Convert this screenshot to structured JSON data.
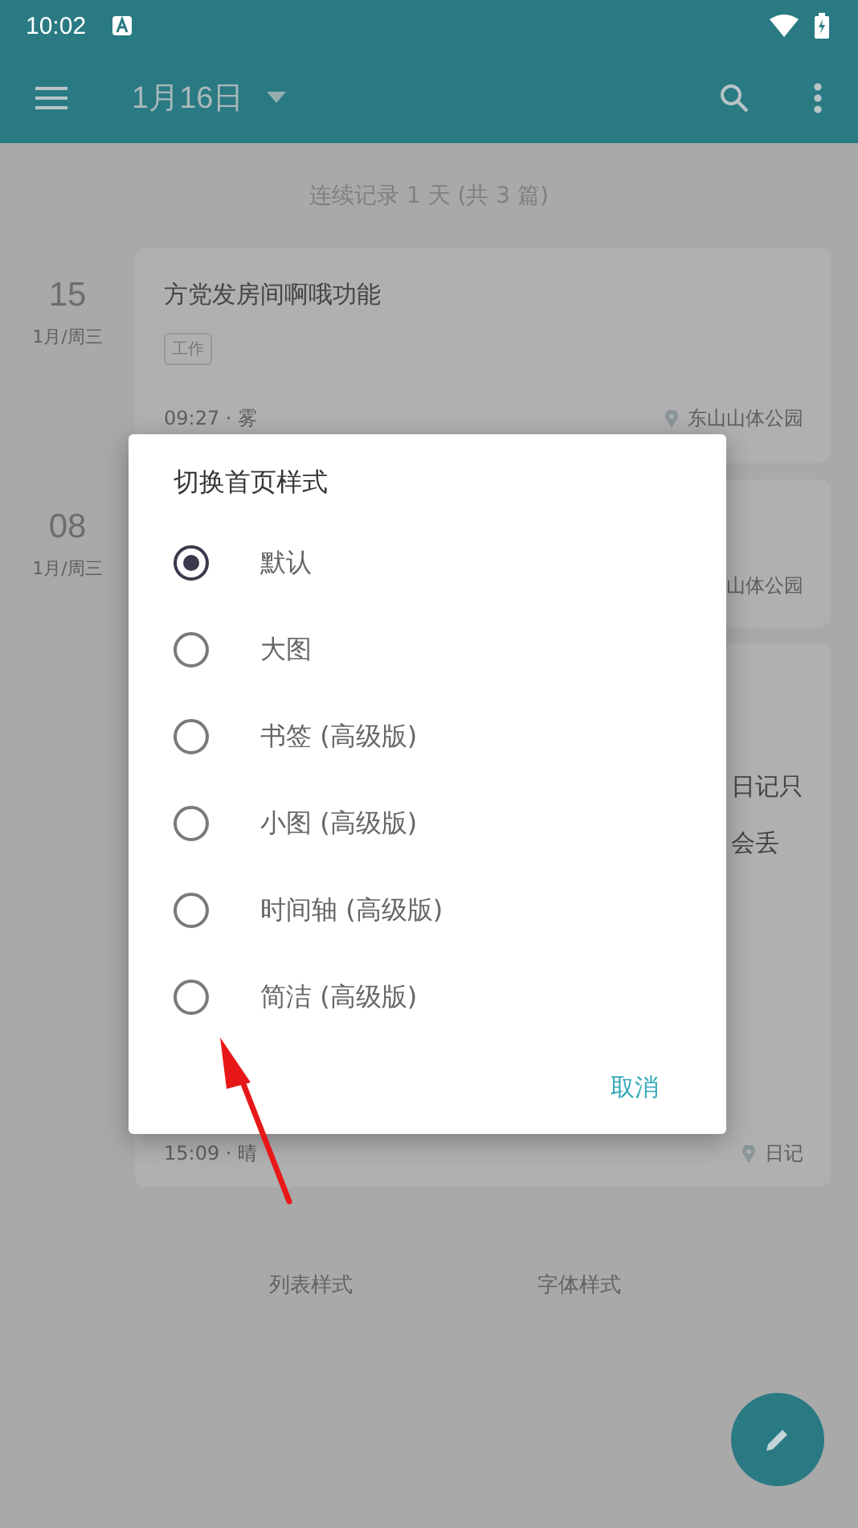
{
  "status_bar": {
    "time": "10:02"
  },
  "toolbar": {
    "title": "1月16日"
  },
  "summary": "连续记录 1 天 (共 3 篇)",
  "entries": [
    {
      "day": "15",
      "weekday": "1月/周三",
      "kind": "full",
      "title": "方党发房间啊哦功能",
      "tag": "工作",
      "time": "09:27 · 雾",
      "location": "东山山体公园"
    },
    {
      "day": "08",
      "weekday": "1月/周三",
      "kind": "covered",
      "location": "山体公园"
    },
    {
      "kind": "long",
      "lines": [
        "日记只",
        "会丢"
      ],
      "time": "15:09 · 晴",
      "location": "日记"
    }
  ],
  "bottom_tabs": [
    "列表样式",
    "字体样式"
  ],
  "dialog": {
    "title": "切换首页样式",
    "options": [
      {
        "label": "默认",
        "selected": true
      },
      {
        "label": "大图",
        "selected": false
      },
      {
        "label": "书签 (高级版)",
        "selected": false
      },
      {
        "label": "小图 (高级版)",
        "selected": false
      },
      {
        "label": "时间轴 (高级版)",
        "selected": false
      },
      {
        "label": "简洁 (高级版)",
        "selected": false
      }
    ],
    "cancel": "取消"
  }
}
